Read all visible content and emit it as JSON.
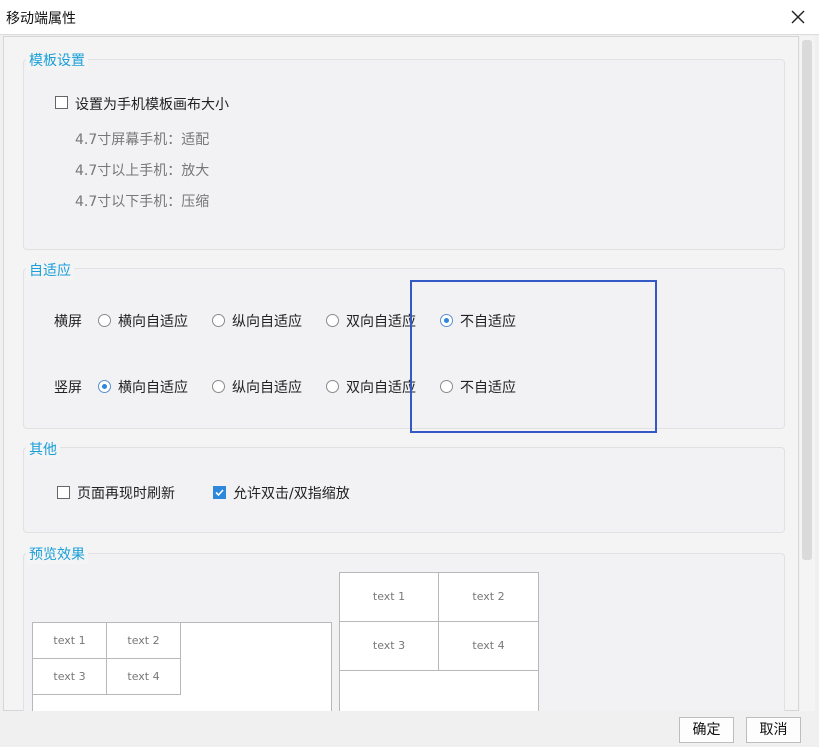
{
  "window": {
    "title": "移动端属性"
  },
  "template_section": {
    "legend": "模板设置",
    "checkbox_label": "设置为手机模板画布大小",
    "checked": false,
    "hints": [
      "4.7寸屏幕手机：适配",
      "4.7寸以上手机：放大",
      "4.7寸以下手机：压缩"
    ]
  },
  "adaptive_section": {
    "legend": "自适应",
    "rows": [
      {
        "label": "横屏",
        "selected": 3,
        "options": [
          "横向自适应",
          "纵向自适应",
          "双向自适应",
          "不自适应"
        ]
      },
      {
        "label": "竖屏",
        "selected": 0,
        "options": [
          "横向自适应",
          "纵向自适应",
          "双向自适应",
          "不自适应"
        ]
      }
    ]
  },
  "other_section": {
    "legend": "其他",
    "refresh_label": "页面再现时刷新",
    "refresh_checked": false,
    "zoom_label": "允许双击/双指缩放",
    "zoom_checked": true
  },
  "preview_section": {
    "legend": "预览效果",
    "left_cells": [
      "text 1",
      "text 2",
      "text 3",
      "text 4"
    ],
    "right_cells": [
      "text 1",
      "text 2",
      "text 3",
      "text 4"
    ]
  },
  "footer": {
    "ok_label": "确定",
    "cancel_label": "取消"
  },
  "colors": {
    "accent": "#2d87db",
    "legend": "#1a9fd9",
    "highlight_box": "#3558c7"
  }
}
